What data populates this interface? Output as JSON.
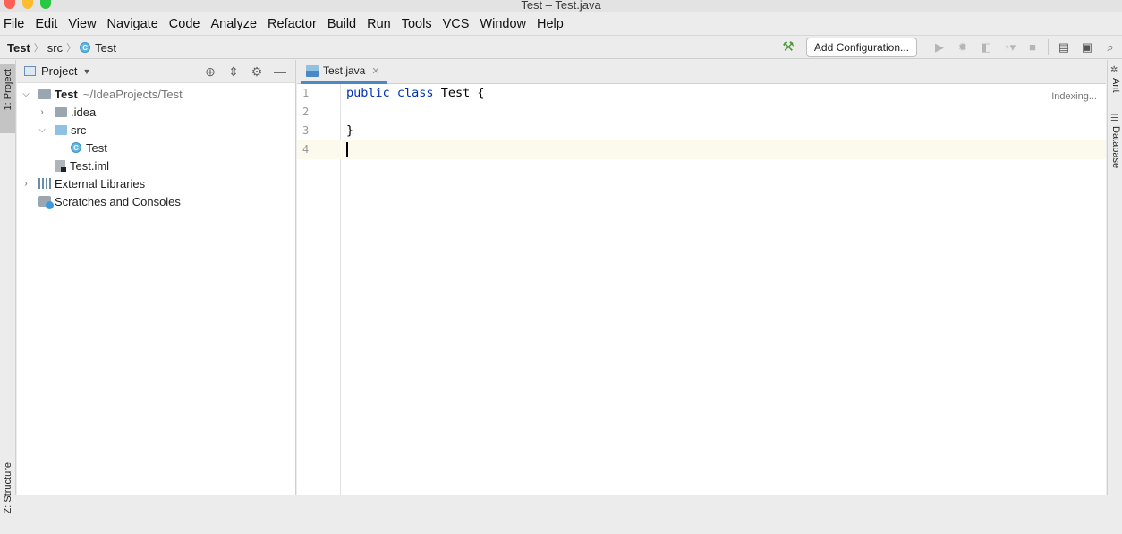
{
  "window": {
    "title": "Test – Test.java"
  },
  "menu": [
    "File",
    "Edit",
    "View",
    "Navigate",
    "Code",
    "Analyze",
    "Refactor",
    "Build",
    "Run",
    "Tools",
    "VCS",
    "Window",
    "Help"
  ],
  "breadcrumbs": {
    "project": "Test",
    "folder": "src",
    "file": "Test"
  },
  "toolbar": {
    "add_config_label": "Add Configuration..."
  },
  "left_strip": {
    "project_tab": "1: Project",
    "structure_tab": "Z: Structure"
  },
  "right_strip": {
    "ant_tab": "Ant",
    "database_tab": "Database"
  },
  "project_panel": {
    "title": "Project",
    "tree": {
      "root_name": "Test",
      "root_path": "~/IdeaProjects/Test",
      "idea_folder": ".idea",
      "src_folder": "src",
      "test_class": "Test",
      "iml_file": "Test.iml",
      "external_libraries": "External Libraries",
      "scratches": "Scratches and Consoles"
    }
  },
  "editor": {
    "tab_label": "Test.java",
    "status": "Indexing...",
    "line_numbers": [
      "1",
      "2",
      "3",
      "4"
    ],
    "code": {
      "kw_public": "public",
      "kw_class": "class",
      "line1_rest": " Test {",
      "line3": "}"
    }
  },
  "colors": {
    "accent": "#4a88c7",
    "keyword": "#0033b3",
    "current_line": "#fcfaed"
  },
  "icons": [
    "hammer-icon",
    "run-icon",
    "debug-icon",
    "coverage-icon",
    "profile-icon",
    "stop-icon",
    "project-structure-icon",
    "terminal-icon",
    "search-icon",
    "locate-icon",
    "collapse-icon",
    "gear-icon",
    "minimize-icon"
  ]
}
